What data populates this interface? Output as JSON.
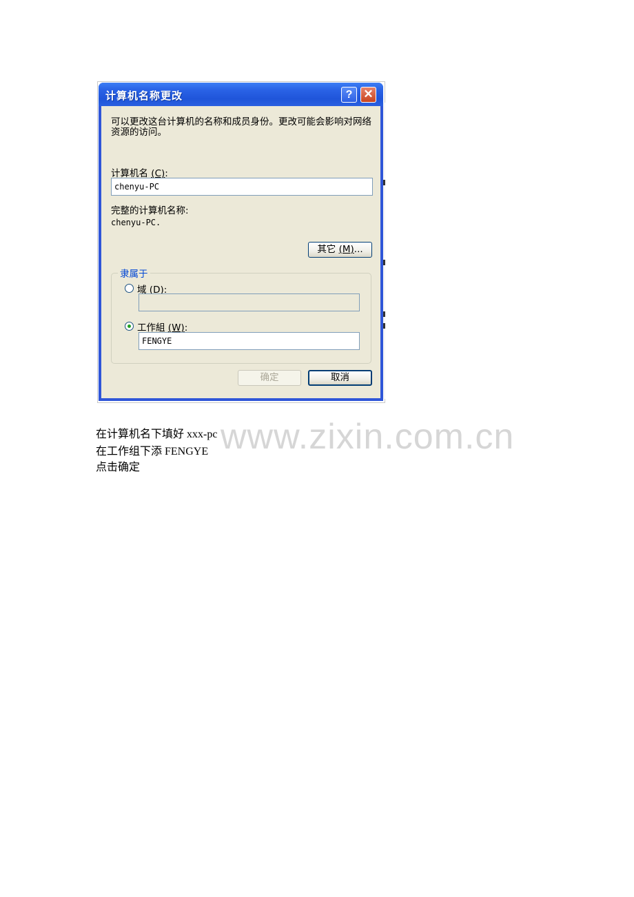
{
  "dialog": {
    "title": "计算机名称更改",
    "help_label": "?",
    "close_label": "✕",
    "description": "可以更改这台计算机的名称和成员身份。更改可能会影响对网络资源的访问。",
    "computer_name_label": "计算机名",
    "computer_name_mnemonic": "(C)",
    "computer_name_colon": ":",
    "computer_name_value": "chenyu-PC",
    "full_name_label": "完整的计算机名称:",
    "full_name_value": "chenyu-PC.",
    "more_button": {
      "label": "其它",
      "mnemonic": "(M)",
      "suffix": "..."
    },
    "member_of": {
      "title": "隶属于",
      "domain": {
        "label": "域",
        "mnemonic": "(D)",
        "colon": ":",
        "selected": false,
        "value": ""
      },
      "workgroup": {
        "label": "工作組",
        "mnemonic": "(W)",
        "colon": ":",
        "selected": true,
        "value": "FENGYE"
      }
    },
    "ok_button": "确定",
    "cancel_button": "取消"
  },
  "instructions": [
    "在计算机名下填好  xxx-pc",
    "在工作组下添  FENGYE",
    "点击确定"
  ],
  "watermark": "www.zixin.com.cn",
  "icons": {
    "help": "question-mark-icon",
    "close": "close-x-icon"
  }
}
